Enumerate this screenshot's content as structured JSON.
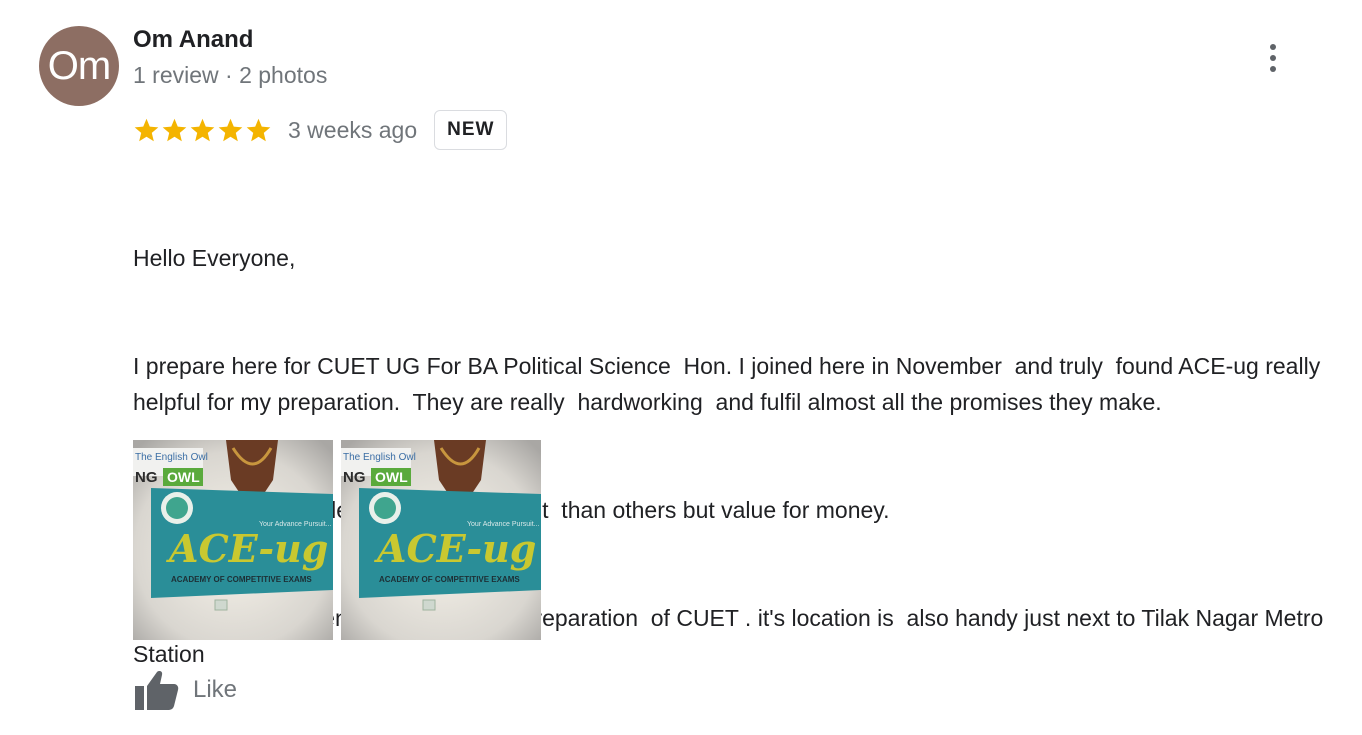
{
  "author": {
    "initials": "Om",
    "name": "Om Anand",
    "meta": "1 review · 2 photos",
    "avatar_color": "#8d6e63"
  },
  "rating": {
    "value": 5,
    "max": 5,
    "star_color": "#f4b400",
    "date": "3 weeks ago",
    "badge": "NEW"
  },
  "review": {
    "lines": [
      "Hello Everyone,",
      "I prepare here for CUET UG For BA Political Science  Hon. I joined here in November  and truly  found ACE-ug really  helpful for my preparation.  They are really  hardworking  and fulfil almost all the promises they make.",
      "The fee some people say a bit exorbitant  than others but value for money.",
      "I strongly  recommend  Ace ug for the preparation  of CUET . it's location is  also handy just next to Tilak Nagar Metro Station"
    ]
  },
  "photos": [
    {
      "sign_label": "ACE-ug",
      "tagline": "Your Advance Pursuit...",
      "subtitle": "ACADEMY OF COMPETITIVE EXAMS",
      "neighbor_text": "The English Owl",
      "neighbor_green": "OWL",
      "neighbor_prefix": "NG"
    },
    {
      "sign_label": "ACE-ug",
      "tagline": "Your Advance Pursuit...",
      "subtitle": "ACADEMY OF COMPETITIVE EXAMS",
      "neighbor_text": "The English Owl",
      "neighbor_green": "OWL",
      "neighbor_prefix": "NG"
    }
  ],
  "actions": {
    "like_label": "Like",
    "more_icon": "more-vert-icon",
    "like_icon": "thumb-up-icon"
  },
  "colors": {
    "text_primary": "#202124",
    "text_secondary": "#70757a",
    "sign_teal": "#2a8e98",
    "sign_yellow": "#c9c830"
  }
}
